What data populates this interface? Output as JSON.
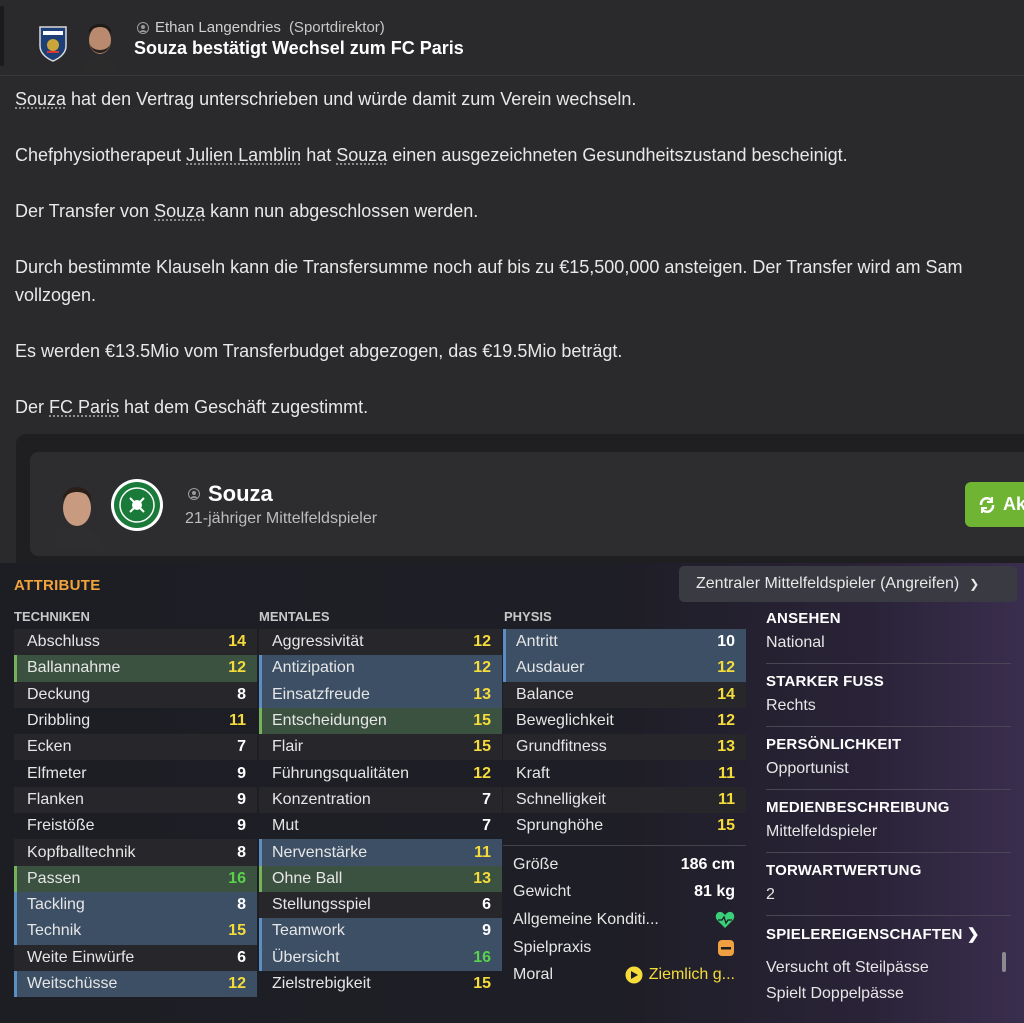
{
  "header": {
    "sender_name": "Ethan Langendries",
    "sender_role": "(Sportdirektor)",
    "subject": "Souza bestätigt Wechsel zum FC Paris"
  },
  "message": {
    "p1": {
      "link": "Souza",
      "text": " hat den Vertrag unterschrieben und würde damit zum Verein wechseln."
    },
    "p2": {
      "pre": "Chefphysiotherapeut ",
      "link1": "Julien Lamblin",
      "mid": " hat ",
      "link2": "Souza",
      "post": " einen ausgezeichneten Gesundheitszustand bescheinigt."
    },
    "p3": {
      "pre": "Der Transfer von ",
      "link": "Souza",
      "post": " kann nun abgeschlossen werden."
    },
    "p4a": "Durch bestimmte Klauseln kann die Transfersumme noch auf bis zu €15,500,000 ansteigen. Der Transfer wird am Sam",
    "p4b": "vollzogen.",
    "p5": "Es werden €13.5Mio vom Transferbudget abgezogen, das €19.5Mio beträgt.",
    "p6": {
      "pre": "Der ",
      "link": "FC Paris",
      "post": " hat dem Geschäft zugestimmt."
    }
  },
  "player": {
    "name": "Souza",
    "description": "21-jähriger Mittelfeldspieler",
    "action_label": "Ak"
  },
  "attributes": {
    "title": "ATTRIBUTE",
    "role_select": "Zentraler Mittelfeldspieler (Angreifen)",
    "techniken_header": "TECHNIKEN",
    "mentales_header": "MENTALES",
    "physis_header": "PHYSIS",
    "techniken": [
      {
        "name": "Abschluss",
        "value": "14"
      },
      {
        "name": "Ballannahme",
        "value": "12"
      },
      {
        "name": "Deckung",
        "value": "8"
      },
      {
        "name": "Dribbling",
        "value": "11"
      },
      {
        "name": "Ecken",
        "value": "7"
      },
      {
        "name": "Elfmeter",
        "value": "9"
      },
      {
        "name": "Flanken",
        "value": "9"
      },
      {
        "name": "Freistöße",
        "value": "9"
      },
      {
        "name": "Kopfballtechnik",
        "value": "8"
      },
      {
        "name": "Passen",
        "value": "16"
      },
      {
        "name": "Tackling",
        "value": "8"
      },
      {
        "name": "Technik",
        "value": "15"
      },
      {
        "name": "Weite Einwürfe",
        "value": "6"
      },
      {
        "name": "Weitschüsse",
        "value": "12"
      }
    ],
    "mentales": [
      {
        "name": "Aggressivität",
        "value": "12"
      },
      {
        "name": "Antizipation",
        "value": "12"
      },
      {
        "name": "Einsatzfreude",
        "value": "13"
      },
      {
        "name": "Entscheidungen",
        "value": "15"
      },
      {
        "name": "Flair",
        "value": "15"
      },
      {
        "name": "Führungsqualitäten",
        "value": "12"
      },
      {
        "name": "Konzentration",
        "value": "7"
      },
      {
        "name": "Mut",
        "value": "7"
      },
      {
        "name": "Nervenstärke",
        "value": "11"
      },
      {
        "name": "Ohne Ball",
        "value": "13"
      },
      {
        "name": "Stellungsspiel",
        "value": "6"
      },
      {
        "name": "Teamwork",
        "value": "9"
      },
      {
        "name": "Übersicht",
        "value": "16"
      },
      {
        "name": "Zielstrebigkeit",
        "value": "15"
      }
    ],
    "physis": [
      {
        "name": "Antritt",
        "value": "10"
      },
      {
        "name": "Ausdauer",
        "value": "12"
      },
      {
        "name": "Balance",
        "value": "14"
      },
      {
        "name": "Beweglichkeit",
        "value": "12"
      },
      {
        "name": "Grundfitness",
        "value": "13"
      },
      {
        "name": "Kraft",
        "value": "11"
      },
      {
        "name": "Schnelligkeit",
        "value": "11"
      },
      {
        "name": "Sprunghöhe",
        "value": "15"
      }
    ],
    "physis_extra": {
      "groesse_label": "Größe",
      "groesse_value": "186 cm",
      "gewicht_label": "Gewicht",
      "gewicht_value": "81 kg",
      "kondition_label": "Allgemeine Konditi...",
      "spielpraxis_label": "Spielpraxis",
      "moral_label": "Moral",
      "moral_value": "Ziemlich g..."
    }
  },
  "info": {
    "ansehen_label": "ANSEHEN",
    "ansehen_value": "National",
    "fuss_label": "STARKER FUSS",
    "fuss_value": "Rechts",
    "persoenlichkeit_label": "PERSÖNLICHKEIT",
    "persoenlichkeit_value": "Opportunist",
    "medien_label": "MEDIENBESCHREIBUNG",
    "medien_value": "Mittelfeldspieler",
    "torwart_label": "TORWARTWERTUNG",
    "torwart_value": "2",
    "traits_label": "SPIELEREIGENSCHAFTEN",
    "traits": [
      "Versucht oft Steilpässe",
      "Spielt Doppelpässe"
    ]
  },
  "colors": {
    "accent_orange": "#f2a43a",
    "value_yellow": "#f5dc3a",
    "value_green": "#58d24a",
    "action_green": "#6fb533"
  }
}
